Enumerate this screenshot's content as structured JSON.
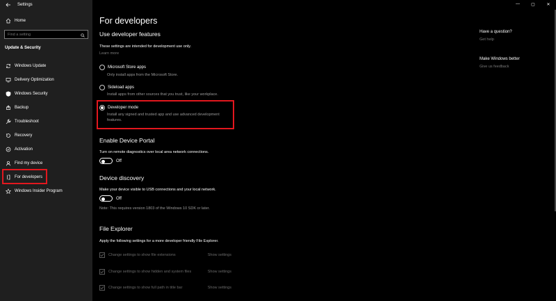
{
  "app": {
    "title": "Settings",
    "home_label": "Home",
    "search_placeholder": "Find a setting",
    "section_header": "Update & Security"
  },
  "nav": [
    {
      "label": "Windows Update",
      "icon": "sync-icon"
    },
    {
      "label": "Delivery Optimization",
      "icon": "delivery-icon"
    },
    {
      "label": "Windows Security",
      "icon": "shield-icon"
    },
    {
      "label": "Backup",
      "icon": "backup-icon"
    },
    {
      "label": "Troubleshoot",
      "icon": "wrench-icon"
    },
    {
      "label": "Recovery",
      "icon": "recovery-icon"
    },
    {
      "label": "Activation",
      "icon": "check-circle-icon"
    },
    {
      "label": "Find my device",
      "icon": "person-location-icon"
    },
    {
      "label": "For developers",
      "icon": "developer-icon"
    },
    {
      "label": "Windows Insider Program",
      "icon": "insider-icon"
    }
  ],
  "selected_nav": "For developers",
  "main": {
    "title": "For developers",
    "use_features_heading": "Use developer features",
    "use_features_desc": "These settings are intended for development use only.",
    "learn_more": "Learn more",
    "options": [
      {
        "label": "Microsoft Store apps",
        "desc": "Only install apps from the Microsoft Store.",
        "checked": false
      },
      {
        "label": "Sideload apps",
        "desc": "Install apps from other sources that you trust, like your workplace.",
        "checked": false
      },
      {
        "label": "Developer mode",
        "desc": "Install any signed and trusted app and use advanced development features.",
        "checked": true
      }
    ],
    "device_portal": {
      "heading": "Enable Device Portal",
      "desc": "Turn on remote diagnostics over local area network connections.",
      "toggle_state": "Off"
    },
    "device_discovery": {
      "heading": "Device discovery",
      "desc": "Make your device visible to USB connections and your local network.",
      "toggle_state": "Off",
      "note": "Note: This requires version 1803 of the Windows 10 SDK or later."
    },
    "file_explorer": {
      "heading": "File Explorer",
      "desc": "Apply the following settings for a more developer friendly File Explorer.",
      "items": [
        {
          "label": "Change settings to show file extensions",
          "link": "Show settings"
        },
        {
          "label": "Change settings to show hidden and system files",
          "link": "Show settings"
        },
        {
          "label": "Change settings to show full path in title bar",
          "link": "Show settings"
        }
      ]
    }
  },
  "aside": {
    "question_heading": "Have a question?",
    "get_help": "Get help",
    "better_heading": "Make Windows better",
    "feedback": "Give us feedback"
  },
  "window_controls": {
    "minimize": "—",
    "maximize": "▢",
    "close": "✕"
  },
  "colors": {
    "highlight": "#e3171e",
    "sidebar_bg": "#1f1f1f",
    "main_bg": "#000000"
  }
}
